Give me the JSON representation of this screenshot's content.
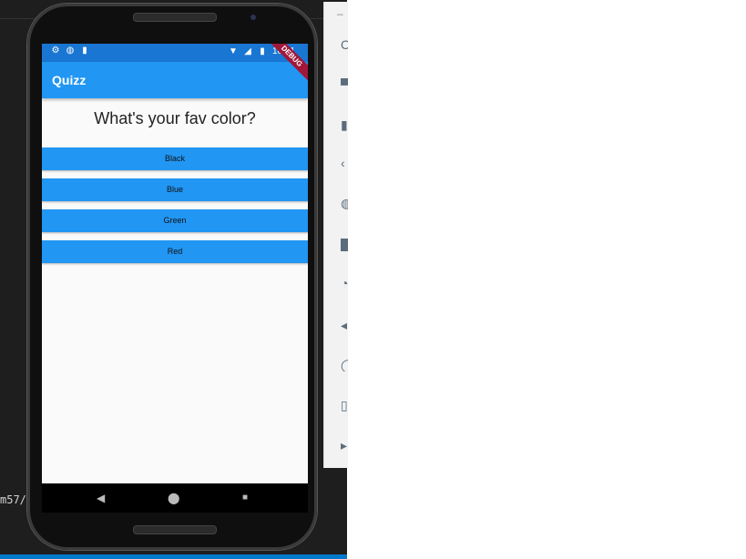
{
  "editor": {
    "snippet": "m57/C"
  },
  "status_bar": {
    "time": "10:51",
    "left_icons": [
      "gear-icon",
      "circle-icon",
      "sd-card-icon"
    ],
    "right_icons": [
      "wifi-icon",
      "signal-icon",
      "battery-icon"
    ]
  },
  "app_bar": {
    "title": "Quizz",
    "debug_banner": "DEBUG"
  },
  "quiz": {
    "question": "What's your fav color?",
    "answers": [
      "Black",
      "Blue",
      "Green",
      "Red"
    ]
  },
  "nav": {
    "back_icon": "◀",
    "home_icon": "⬤",
    "recent_icon": "■"
  },
  "toolbar_glyphs": [
    "–",
    "C",
    "▀",
    "▮",
    "‹",
    "◍",
    "█",
    "◔",
    "◂",
    "◯",
    "▯",
    "▸"
  ]
}
